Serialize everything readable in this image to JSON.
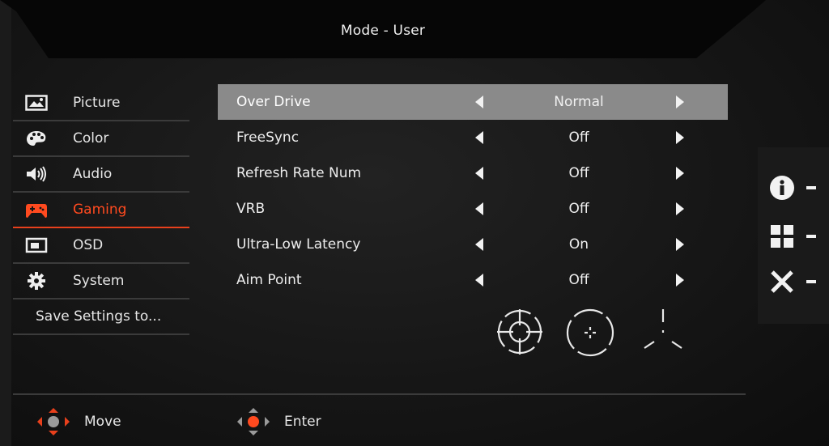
{
  "header": {
    "title": "Mode - User"
  },
  "nav": {
    "items": [
      {
        "label": "Picture",
        "icon": "picture-icon"
      },
      {
        "label": "Color",
        "icon": "palette-icon"
      },
      {
        "label": "Audio",
        "icon": "speaker-icon"
      },
      {
        "label": "Gaming",
        "icon": "gamepad-icon",
        "active": true
      },
      {
        "label": "OSD",
        "icon": "osd-icon"
      },
      {
        "label": "System",
        "icon": "gear-icon"
      },
      {
        "label": "Save Settings to..."
      }
    ]
  },
  "settings": {
    "rows": [
      {
        "label": "Over Drive",
        "value": "Normal",
        "selected": true
      },
      {
        "label": "FreeSync",
        "value": "Off"
      },
      {
        "label": "Refresh Rate Num",
        "value": "Off"
      },
      {
        "label": "VRB",
        "value": "Off"
      },
      {
        "label": "Ultra-Low Latency",
        "value": "On"
      },
      {
        "label": "Aim Point",
        "value": "Off"
      }
    ]
  },
  "aim_point_options": [
    "crosshair-circle-icon",
    "crosshair-dot-icon",
    "crosshair-tri-icon"
  ],
  "hotkeys": [
    "info-icon",
    "input-grid-icon",
    "close-icon"
  ],
  "footer": {
    "move_label": "Move",
    "enter_label": "Enter"
  },
  "colors": {
    "accent": "#e8401c",
    "selected_row": "#8a8a8a",
    "background": "#151515"
  }
}
